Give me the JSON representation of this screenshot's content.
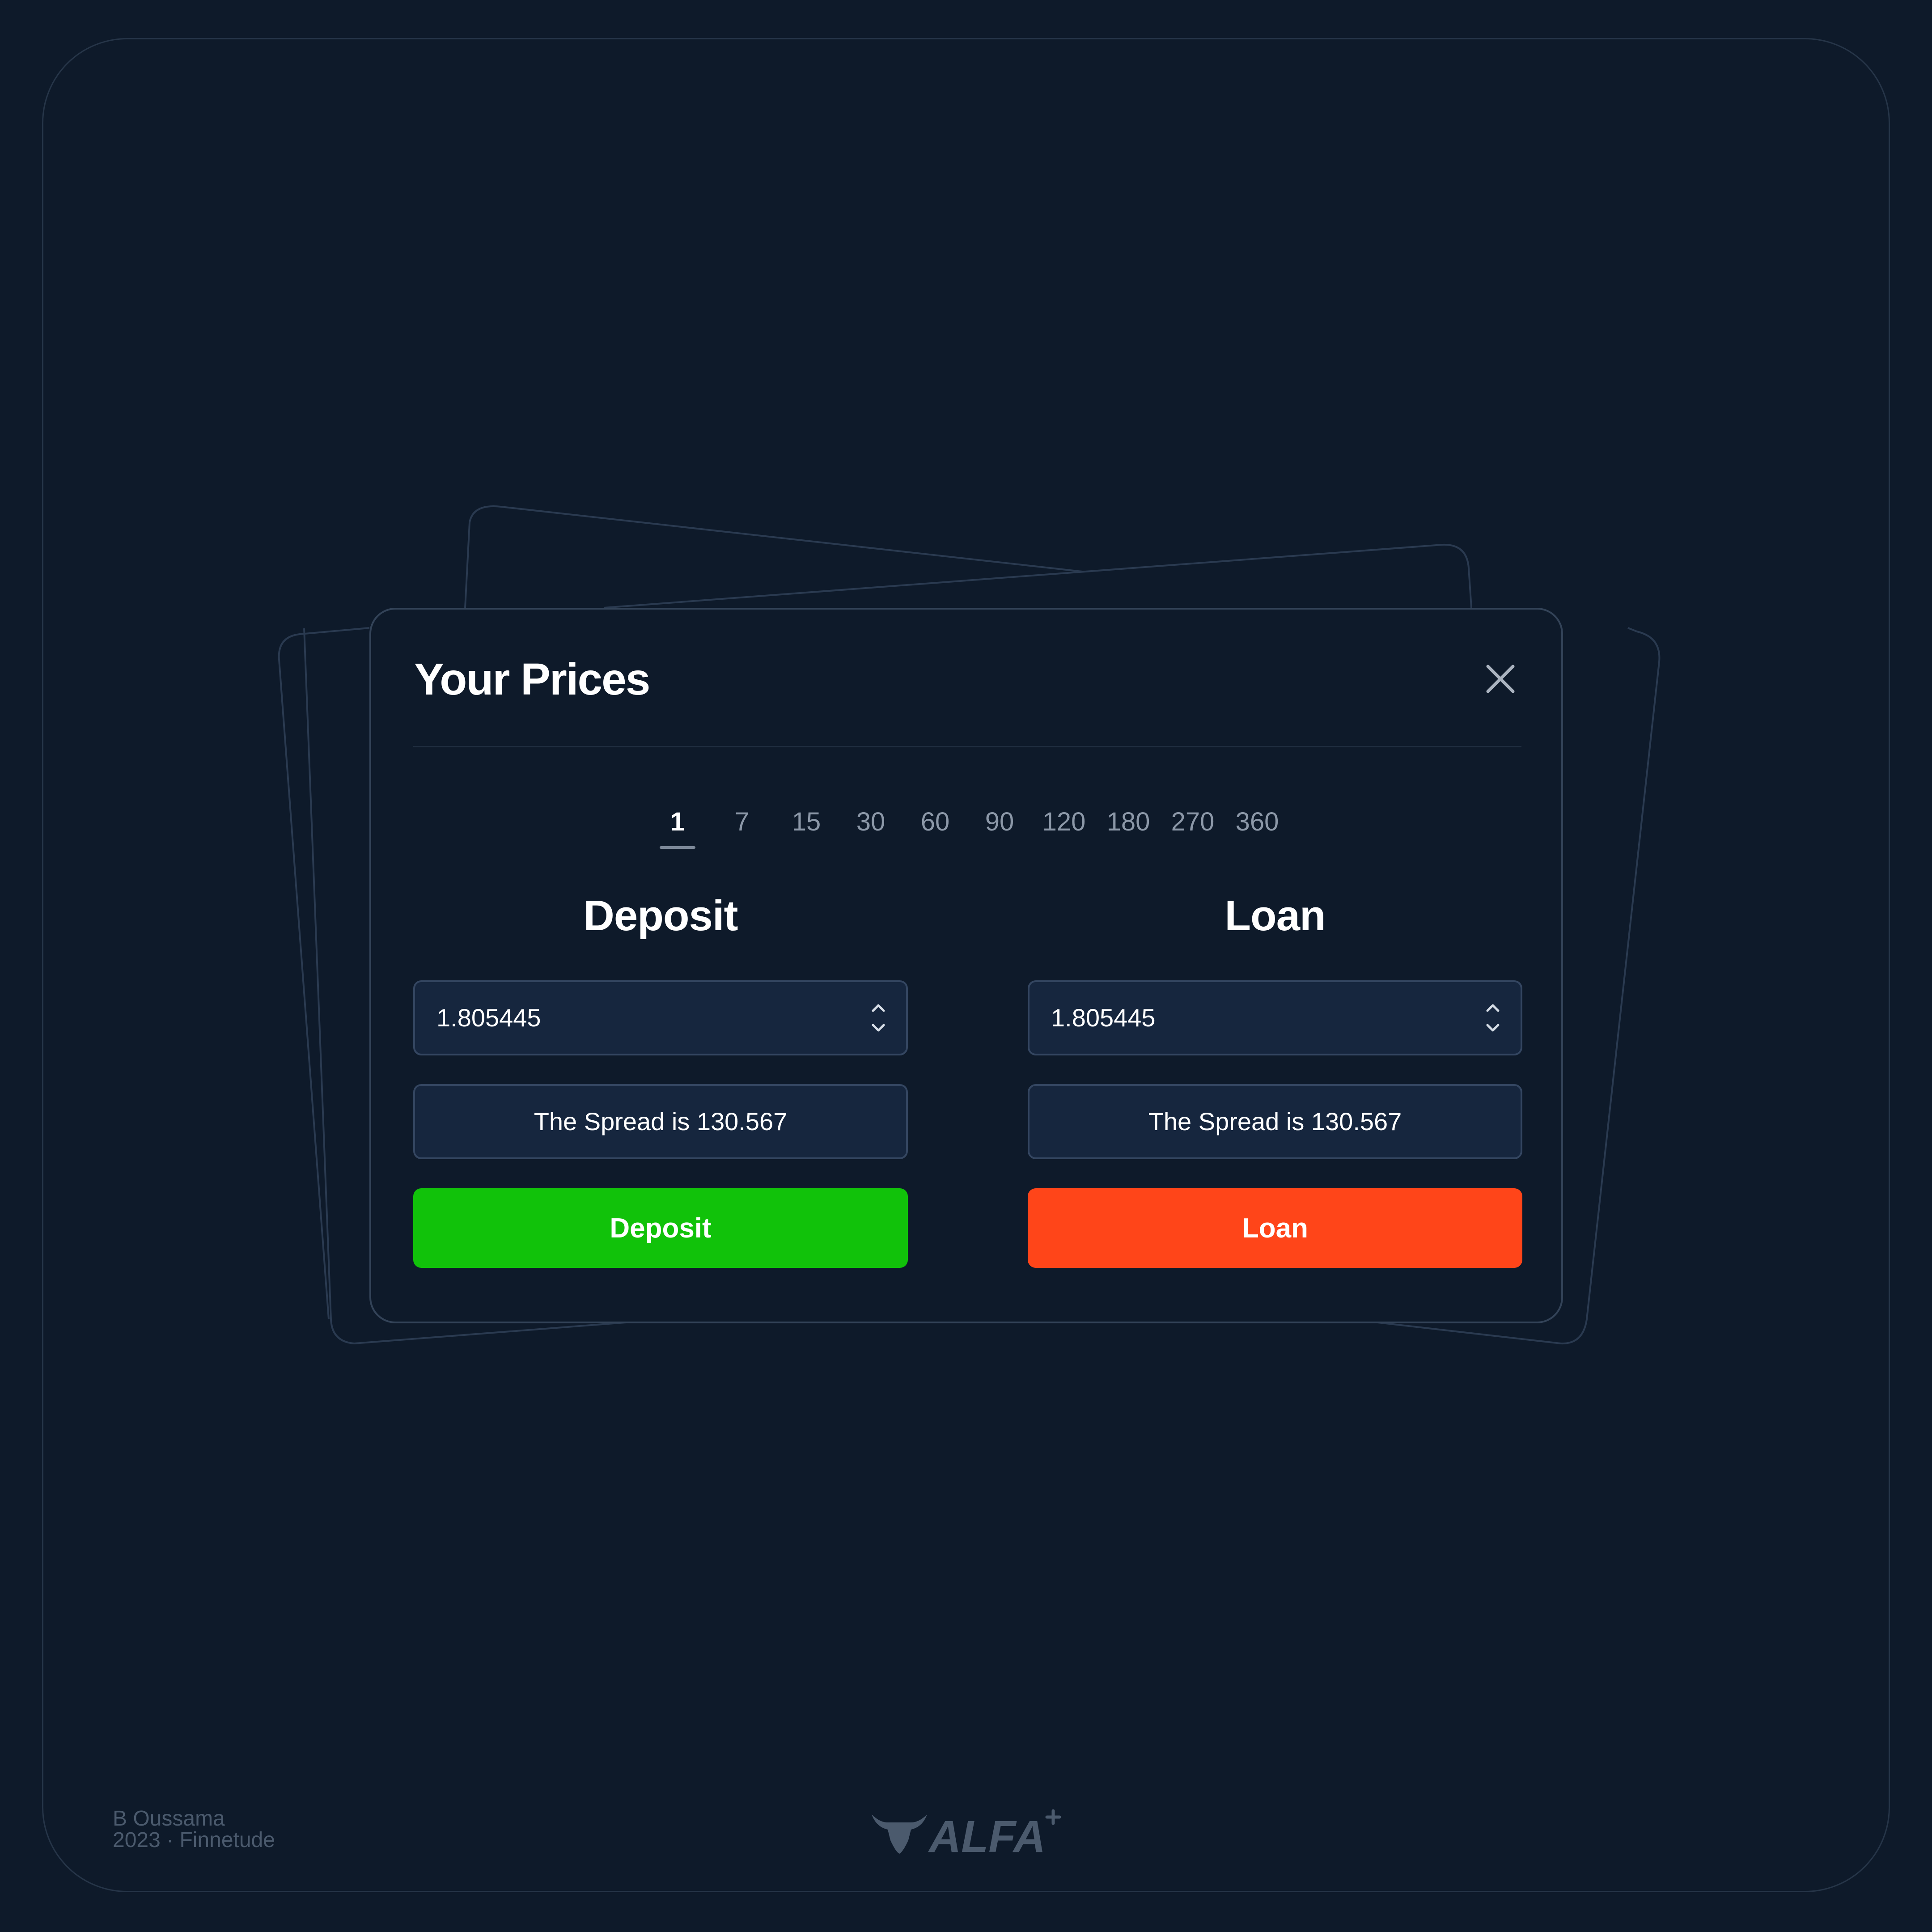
{
  "modal": {
    "title": "Your Prices",
    "close_icon": "close-icon"
  },
  "periods": {
    "options": [
      "1",
      "7",
      "15",
      "30",
      "60",
      "90",
      "120",
      "180",
      "270",
      "360"
    ],
    "selected": "1"
  },
  "deposit": {
    "heading": "Deposit",
    "rate_value": "1.805445",
    "spread_text": "The Spread is 130.567",
    "button_label": "Deposit",
    "button_color": "#11c20a"
  },
  "loan": {
    "heading": "Loan",
    "rate_value": "1.805445",
    "spread_text": "The Spread is 130.567",
    "button_label": "Loan",
    "button_color": "#ff4519"
  },
  "footer": {
    "author": "B Oussama",
    "year_org": "2023 · Finnetude",
    "logo_text": "ALFA",
    "logo_icon": "bull-icon"
  },
  "colors": {
    "background": "#0e1a2a",
    "panel_border": "#334358",
    "field_bg": "#16263e",
    "field_border": "#344661"
  }
}
